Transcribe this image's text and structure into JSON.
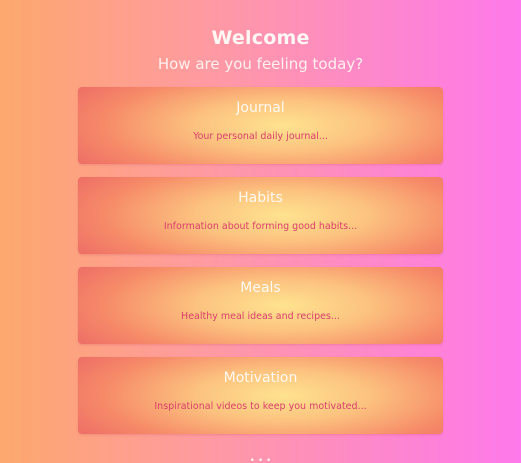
{
  "header": {
    "title": "Welcome",
    "subtitle": "How are you feeling today?"
  },
  "cards": [
    {
      "title": "Journal",
      "description": "Your personal daily journal..."
    },
    {
      "title": "Habits",
      "description": "Information about forming good habits..."
    },
    {
      "title": "Meals",
      "description": "Healthy meal ideas and recipes..."
    },
    {
      "title": "Motivation",
      "description": "Inspirational videos to keep you motivated..."
    }
  ],
  "footer": {
    "text": "• • •"
  },
  "colors": {
    "background_left": "#fda86d",
    "background_right": "#fe79eb",
    "card_center": "#fee390",
    "card_edge": "#ed6b66",
    "description_text": "#d9406a"
  }
}
